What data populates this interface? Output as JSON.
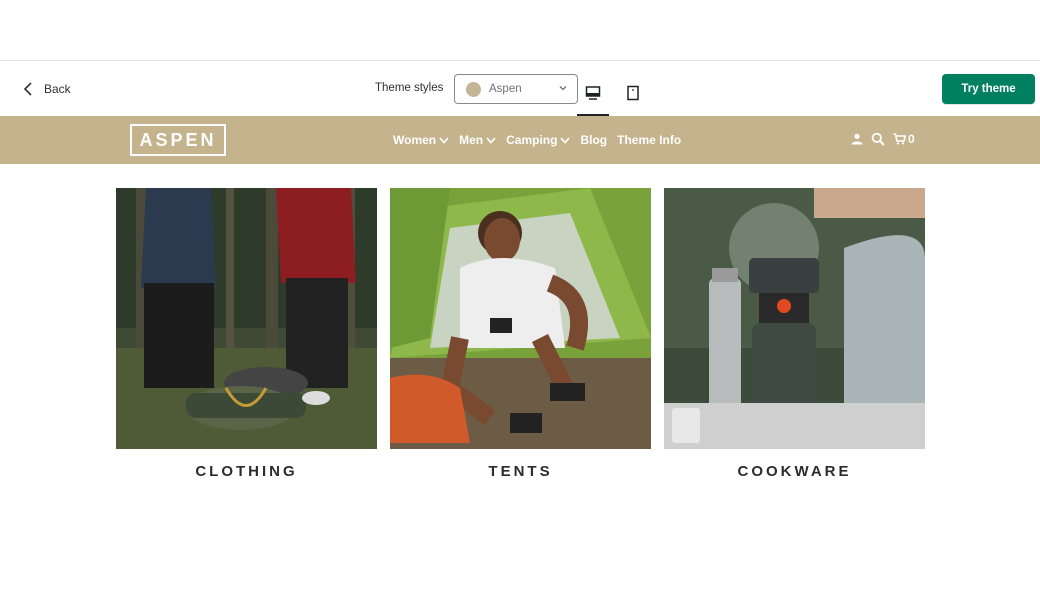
{
  "toolbar": {
    "back_label": "Back",
    "theme_styles_label": "Theme styles",
    "selected_style": "Aspen",
    "swatch_color": "#c4b596",
    "device_views": [
      "desktop-icon",
      "tablet-icon"
    ],
    "active_device": "desktop",
    "try_label": "Try theme",
    "try_color": "#008060"
  },
  "store": {
    "header_color": "#c4b38c",
    "logo_text": "ASPEN",
    "nav": [
      {
        "label": "Women",
        "dropdown": true
      },
      {
        "label": "Men",
        "dropdown": true
      },
      {
        "label": "Camping",
        "dropdown": true
      },
      {
        "label": "Blog",
        "dropdown": false
      },
      {
        "label": "Theme Info",
        "dropdown": false
      }
    ],
    "cart_count": "0"
  },
  "collections": [
    {
      "title": "CLOTHING"
    },
    {
      "title": "TENTS"
    },
    {
      "title": "COOKWARE"
    }
  ]
}
